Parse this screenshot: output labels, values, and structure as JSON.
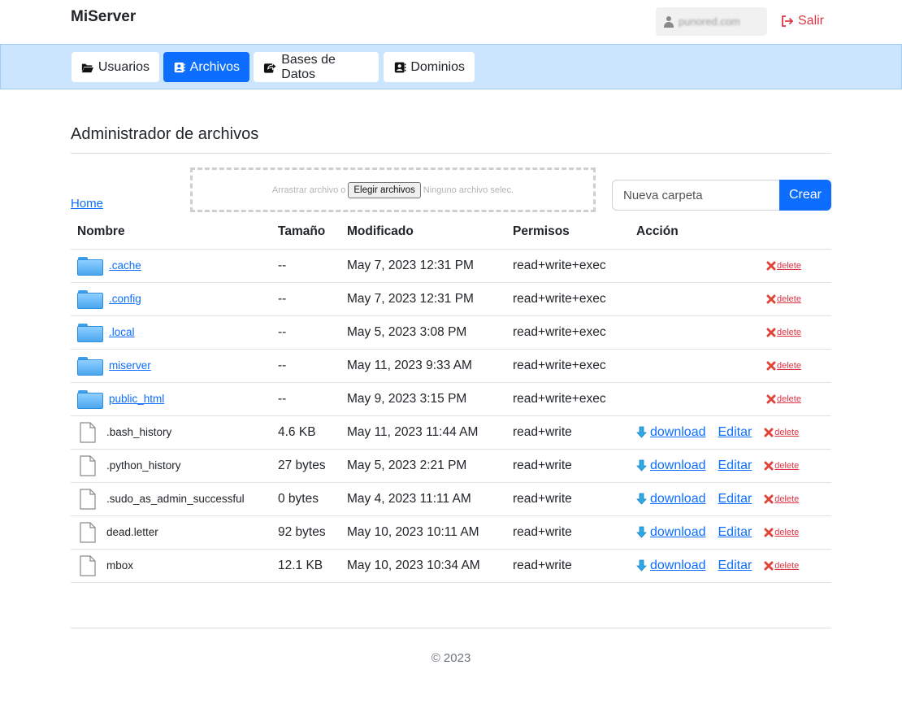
{
  "header": {
    "brand": "MiServer",
    "username": "punored.com",
    "logout_label": "Salir"
  },
  "nav": {
    "tabs": [
      {
        "label": "Usuarios",
        "icon": "folder-open-icon",
        "active": false
      },
      {
        "label": "Archivos",
        "icon": "contact-card-icon",
        "active": true
      },
      {
        "label": "Bases de Datos",
        "icon": "share-square-icon",
        "active": false
      },
      {
        "label": "Dominios",
        "icon": "address-book-icon",
        "active": false
      }
    ]
  },
  "main": {
    "title": "Administrador de archivos",
    "breadcrumb_home": "Home",
    "upload": {
      "drag_text": "Arrastrar archivo o",
      "choose_button": "Elegir archivos",
      "no_file_text": "Ninguno archivo selec."
    },
    "new_folder": {
      "placeholder": "Nueva carpeta",
      "create_button": "Crear"
    },
    "table": {
      "headers": [
        "Nombre",
        "Tamaño",
        "Modificado",
        "Permisos",
        "Acción"
      ],
      "rows": [
        {
          "type": "folder",
          "name": ".cache",
          "size": "--",
          "modified": "May 7, 2023 12:31 PM",
          "permissions": "read+write+exec"
        },
        {
          "type": "folder",
          "name": ".config",
          "size": "--",
          "modified": "May 7, 2023 12:31 PM",
          "permissions": "read+write+exec"
        },
        {
          "type": "folder",
          "name": ".local",
          "size": "--",
          "modified": "May 5, 2023 3:08 PM",
          "permissions": "read+write+exec"
        },
        {
          "type": "folder",
          "name": "miserver",
          "size": "--",
          "modified": "May 11, 2023 9:33 AM",
          "permissions": "read+write+exec"
        },
        {
          "type": "folder",
          "name": "public_html",
          "size": "--",
          "modified": "May 9, 2023 3:15 PM",
          "permissions": "read+write+exec"
        },
        {
          "type": "file",
          "name": ".bash_history",
          "size": "4.6 KB",
          "modified": "May 11, 2023 11:44 AM",
          "permissions": "read+write"
        },
        {
          "type": "file",
          "name": ".python_history",
          "size": "27 bytes",
          "modified": "May 5, 2023 2:21 PM",
          "permissions": "read+write"
        },
        {
          "type": "file",
          "name": ".sudo_as_admin_successful",
          "size": "0 bytes",
          "modified": "May 4, 2023 11:11 AM",
          "permissions": "read+write"
        },
        {
          "type": "file",
          "name": "dead.letter",
          "size": "92 bytes",
          "modified": "May 10, 2023 10:11 AM",
          "permissions": "read+write"
        },
        {
          "type": "file",
          "name": "mbox",
          "size": "12.1 KB",
          "modified": "May 10, 2023 10:34 AM",
          "permissions": "read+write"
        }
      ],
      "download_label": "download",
      "edit_label": "Editar",
      "delete_label": "delete"
    }
  },
  "footer": {
    "copyright": "© 2023"
  },
  "colors": {
    "primary": "#0d6efd",
    "danger": "#dc3545",
    "nav_bg": "#cce5ff"
  }
}
